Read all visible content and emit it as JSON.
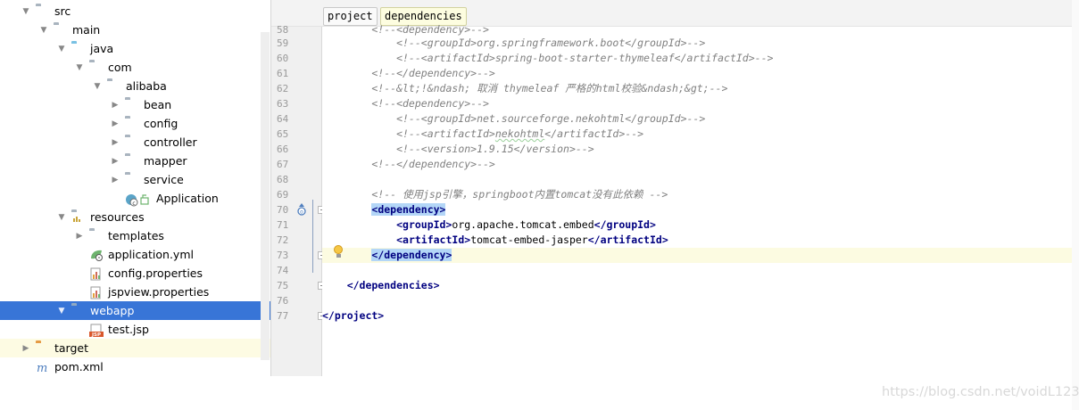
{
  "tree": {
    "items": [
      {
        "label": "src",
        "icon": "folder-icon",
        "arrow": "▼"
      },
      {
        "label": "main",
        "icon": "folder-icon",
        "arrow": "▼"
      },
      {
        "label": "java",
        "icon": "source-folder-icon",
        "arrow": "▼"
      },
      {
        "label": "com",
        "icon": "package-icon",
        "arrow": "▼"
      },
      {
        "label": "alibaba",
        "icon": "package-icon",
        "arrow": "▼"
      },
      {
        "label": "bean",
        "icon": "package-icon",
        "arrow": "▶"
      },
      {
        "label": "config",
        "icon": "package-icon",
        "arrow": "▶"
      },
      {
        "label": "controller",
        "icon": "package-icon",
        "arrow": "▶"
      },
      {
        "label": "mapper",
        "icon": "package-icon",
        "arrow": "▶"
      },
      {
        "label": "service",
        "icon": "package-icon",
        "arrow": "▶"
      },
      {
        "label": "Application",
        "icon": "spring-boot-class-icon",
        "arrow": ""
      },
      {
        "label": "resources",
        "icon": "resources-folder-icon",
        "arrow": "▼"
      },
      {
        "label": "templates",
        "icon": "folder-icon",
        "arrow": "▶"
      },
      {
        "label": "application.yml",
        "icon": "yml-file-icon",
        "arrow": ""
      },
      {
        "label": "config.properties",
        "icon": "properties-file-icon",
        "arrow": ""
      },
      {
        "label": "jspview.properties",
        "icon": "properties-file-icon",
        "arrow": ""
      },
      {
        "label": "webapp",
        "icon": "web-folder-icon",
        "arrow": "▼"
      },
      {
        "label": "test.jsp",
        "icon": "jsp-file-icon",
        "arrow": ""
      },
      {
        "label": "target",
        "icon": "excluded-folder-icon",
        "arrow": "▶"
      },
      {
        "label": "pom.xml",
        "icon": "maven-icon",
        "arrow": ""
      }
    ]
  },
  "editor": {
    "breadcrumbs": [
      "project",
      "dependencies"
    ],
    "line_numbers": [
      "58",
      "59",
      "60",
      "61",
      "62",
      "63",
      "64",
      "65",
      "66",
      "67",
      "68",
      "69",
      "70",
      "71",
      "72",
      "73",
      "74",
      "75",
      "76",
      "77"
    ],
    "lines": {
      "l58": "        <!--<dependency>-->",
      "l59a": "            <!--<groupId>org.springframework.boot</groupId>-->",
      "l60": "            <!--<artifactId>spring-boot-starter-thymeleaf</artifactId>-->",
      "l61": "        <!--</dependency>-->",
      "l62": "        <!--&lt;!&ndash; 取消 thymeleaf 严格的html校验&ndash;&gt;-->",
      "l63": "        <!--<dependency>-->",
      "l64": "            <!--<groupId>net.sourceforge.nekohtml</groupId>-->",
      "l65_pre": "            <!--<artifactId>",
      "l65_word": "nekohtml",
      "l65_post": "</artifactId>-->",
      "l66": "            <!--<version>1.9.15</version>-->",
      "l67": "        <!--</dependency>-->",
      "l69": "        <!-- 使用jsp引擎，springboot内置tomcat没有此依赖 -->",
      "l70_tag": "<dependency>",
      "l71_open": "<groupId>",
      "l71_val": "org.apache.tomcat.embed",
      "l71_close": "</groupId>",
      "l72_open": "<artifactId>",
      "l72_val": "tomcat-embed-jasper",
      "l72_close": "</artifactId>",
      "l73_tag": "</dependency>",
      "l75": "    </dependencies>",
      "l77": "</project>"
    }
  },
  "watermark": "https://blog.csdn.net/voidL123",
  "colors": {
    "selection": "#3875d7",
    "tag": "#000080",
    "comment": "#808080",
    "tag_match_bg": "#b3d6f7",
    "current_line": "#fcfbe1"
  }
}
